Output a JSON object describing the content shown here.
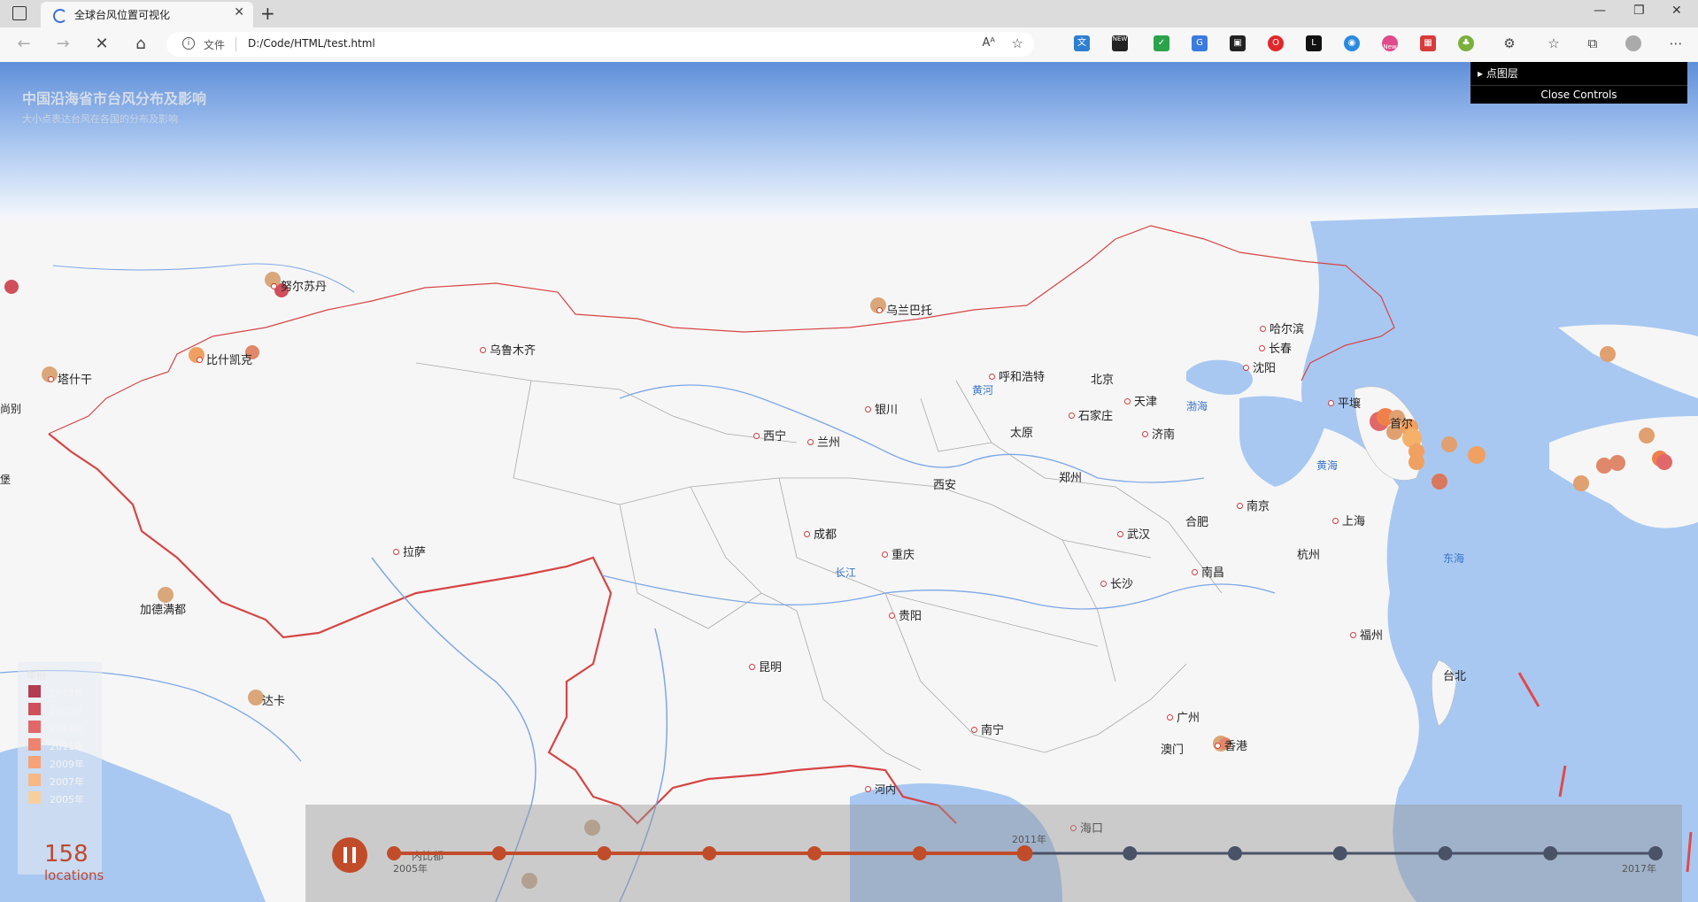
{
  "browser": {
    "tab_title": "全球台风位置可视化",
    "address_prefix": "文件",
    "url": "D:/Code/HTML/test.html",
    "read_aloud_label": "Aᴬ",
    "new_ext_badge": "NEW",
    "new_ext_badge2": "New"
  },
  "page": {
    "title": "中国沿海省市台风分布及影响",
    "subtitle": "大小点表达台风在各国的分布及影响"
  },
  "gui": {
    "folder_label": "点图层",
    "close_label": "Close Controls"
  },
  "legend": {
    "title": "年份",
    "items": [
      {
        "label": "2017年",
        "color": "#b23c52"
      },
      {
        "label": "2015年",
        "color": "#cf4f5b"
      },
      {
        "label": "2013年",
        "color": "#e0686a"
      },
      {
        "label": "2011年",
        "color": "#ee8470"
      },
      {
        "label": "2009年",
        "color": "#f5a277"
      },
      {
        "label": "2007年",
        "color": "#f7b883"
      },
      {
        "label": "2005年",
        "color": "#f7cf9f"
      }
    ]
  },
  "stats": {
    "count": "158",
    "count_label": "locations"
  },
  "timeline": {
    "start_label": "2005年",
    "mid_label": "2011年",
    "end_label": "2017年",
    "active_color": "#c14c2a",
    "inactive_color": "#4a5268",
    "progress_fraction": 0.5
  },
  "cities": [
    {
      "name": "努尔苏丹"
    },
    {
      "name": "乌兰巴托"
    },
    {
      "name": "比什凯克"
    },
    {
      "name": "塔什干"
    },
    {
      "name": "乌鲁木齐"
    },
    {
      "name": "哈尔滨"
    },
    {
      "name": "长春"
    },
    {
      "name": "沈阳"
    },
    {
      "name": "呼和浩特"
    },
    {
      "name": "北京"
    },
    {
      "name": "天津"
    },
    {
      "name": "银川"
    },
    {
      "name": "石家庄"
    },
    {
      "name": "太原"
    },
    {
      "name": "济南"
    },
    {
      "name": "西宁"
    },
    {
      "name": "兰州"
    },
    {
      "name": "平壤"
    },
    {
      "name": "首尔"
    },
    {
      "name": "西安"
    },
    {
      "name": "郑州"
    },
    {
      "name": "南京"
    },
    {
      "name": "合肥"
    },
    {
      "name": "上海"
    },
    {
      "name": "武汉"
    },
    {
      "name": "成都"
    },
    {
      "name": "杭州"
    },
    {
      "name": "拉萨"
    },
    {
      "name": "重庆"
    },
    {
      "name": "南昌"
    },
    {
      "name": "长沙"
    },
    {
      "name": "贵阳"
    },
    {
      "name": "福州"
    },
    {
      "name": "加德满都"
    },
    {
      "name": "昆明"
    },
    {
      "name": "台北"
    },
    {
      "name": "达卡"
    },
    {
      "name": "广州"
    },
    {
      "name": "南宁"
    },
    {
      "name": "澳门"
    },
    {
      "name": "香港"
    },
    {
      "name": "河内"
    },
    {
      "name": "海口"
    },
    {
      "name": "内比都"
    },
    {
      "name": "尚别"
    },
    {
      "name": "堡"
    }
  ],
  "seas": [
    {
      "name": "渤海"
    },
    {
      "name": "黄海"
    },
    {
      "name": "东海"
    },
    {
      "name": "黄河"
    },
    {
      "name": "长江"
    }
  ]
}
